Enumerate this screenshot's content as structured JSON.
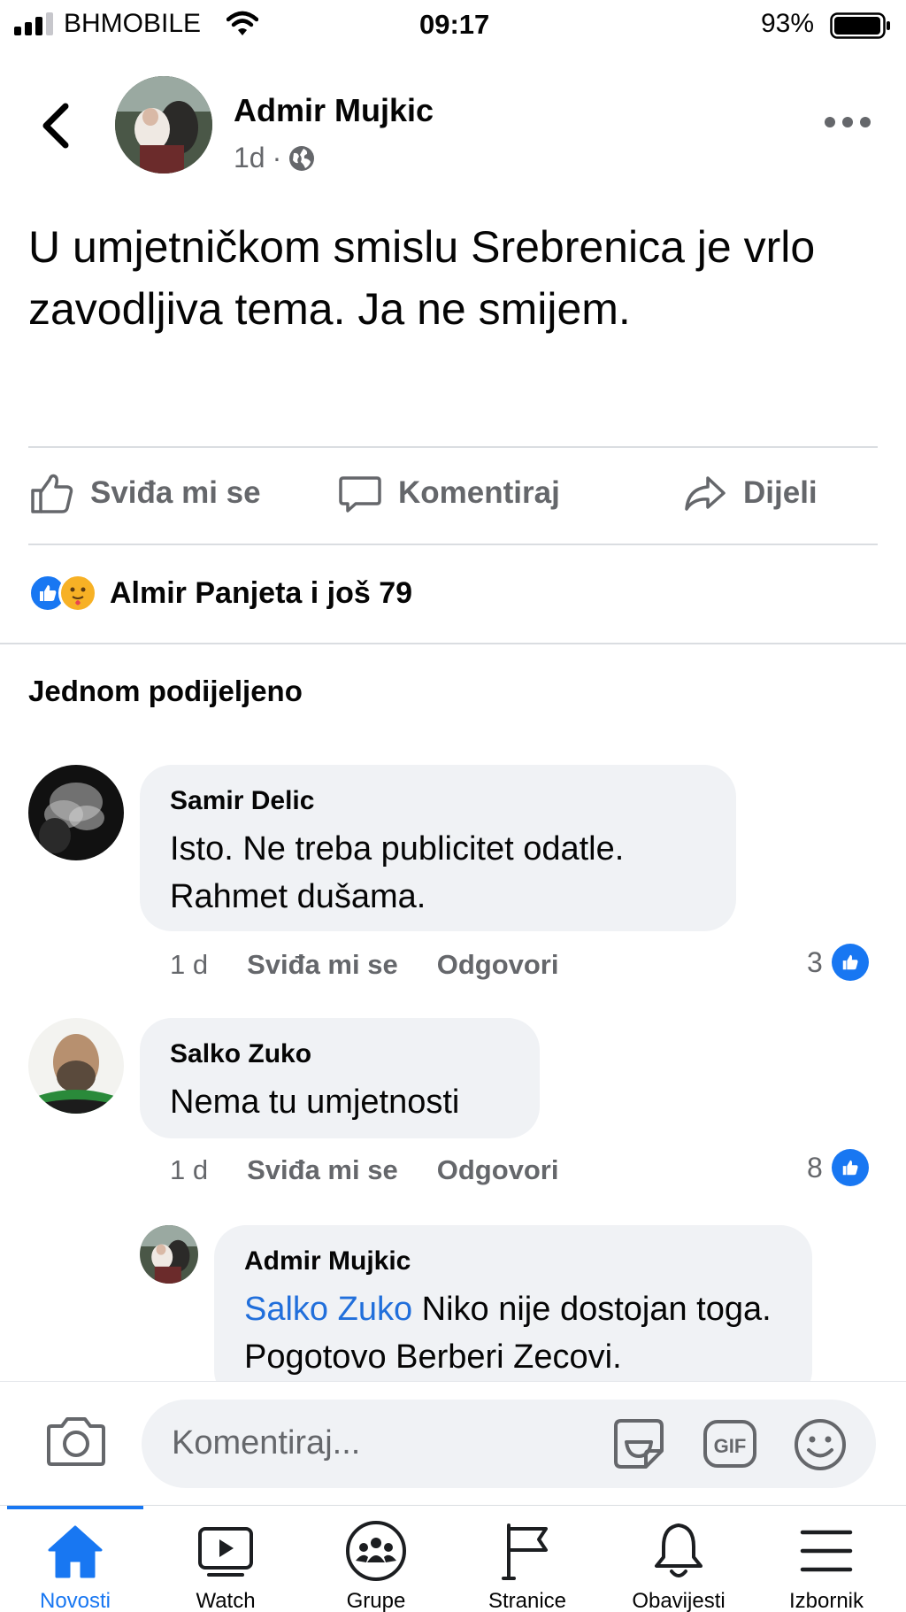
{
  "status_bar": {
    "carrier": "BHMOBILE",
    "time": "09:17",
    "battery": "93%"
  },
  "post": {
    "author": "Admir Mujkic",
    "age": "1d",
    "dot": "·",
    "text": "U umjetničkom smislu Srebrenica je vrlo zavodljiva tema. Ja ne smijem.",
    "actions": {
      "like": "Sviđa mi se",
      "comment": "Komentiraj",
      "share": "Dijeli"
    },
    "reactions_text": "Almir Panjeta i još 79",
    "shared_label": "Jednom podijeljeno"
  },
  "comments": [
    {
      "author": "Samir Delic",
      "text": "Isto. Ne treba publicitet odatle. Rahmet dušama.",
      "age": "1 d",
      "like": "Sviđa mi se",
      "reply": "Odgovori",
      "likes": "3"
    },
    {
      "author": "Salko Zuko",
      "text": "Nema tu umjetnosti",
      "age": "1 d",
      "like": "Sviđa mi se",
      "reply": "Odgovori",
      "likes": "8"
    }
  ],
  "reply": {
    "author": "Admir Mujkic",
    "mention": "Salko Zuko",
    "text": "Niko nije dostojan toga. Pogotovo Berberi Zecovi."
  },
  "composer": {
    "placeholder": "Komentiraj...",
    "gif_label": "GIF"
  },
  "tabs": [
    {
      "label": "Novosti",
      "icon": "home-icon",
      "active": true
    },
    {
      "label": "Watch",
      "icon": "watch-icon"
    },
    {
      "label": "Grupe",
      "icon": "groups-icon"
    },
    {
      "label": "Stranice",
      "icon": "pages-flag-icon"
    },
    {
      "label": "Obavijesti",
      "icon": "bell-icon"
    },
    {
      "label": "Izbornik",
      "icon": "menu-icon"
    }
  ],
  "colors": {
    "accent": "#1877f2",
    "secondary_text": "#65676b",
    "bubble": "#f0f2f5",
    "mention": "#216fdb"
  }
}
